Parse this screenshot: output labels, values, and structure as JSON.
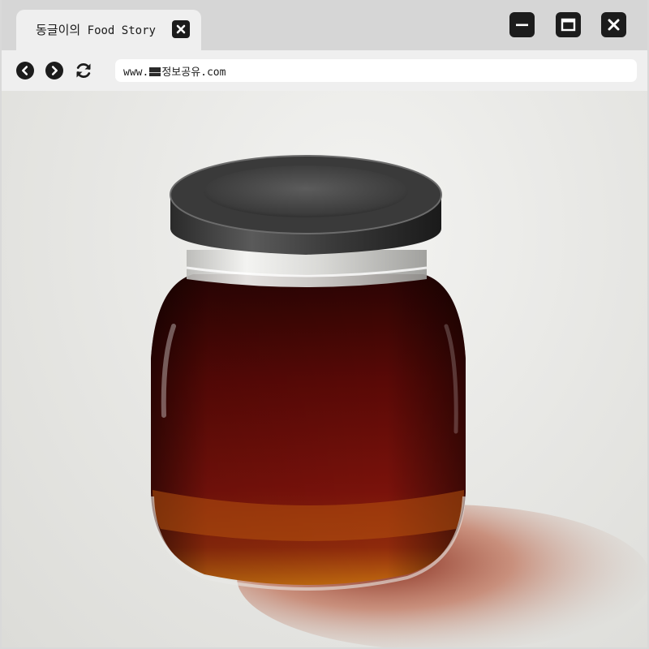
{
  "tab": {
    "title_korean": "동글이의",
    "title_english": "Food Story"
  },
  "toolbar": {
    "address_prefix": "www.",
    "address_suffix": "정보공유.com"
  },
  "icons": {
    "tab_close": "close-icon",
    "minimize": "minimize-icon",
    "maximize": "maximize-icon",
    "close": "close-icon",
    "back": "back-arrow-icon",
    "forward": "forward-arrow-icon",
    "refresh": "refresh-icon"
  },
  "colors": {
    "chrome_dark": "#1c1c1c",
    "tab_strip": "#d6d6d6",
    "toolbar": "#efefef",
    "jar_liquid": "#6e0f08",
    "jar_lid": "#2b2b2b"
  }
}
